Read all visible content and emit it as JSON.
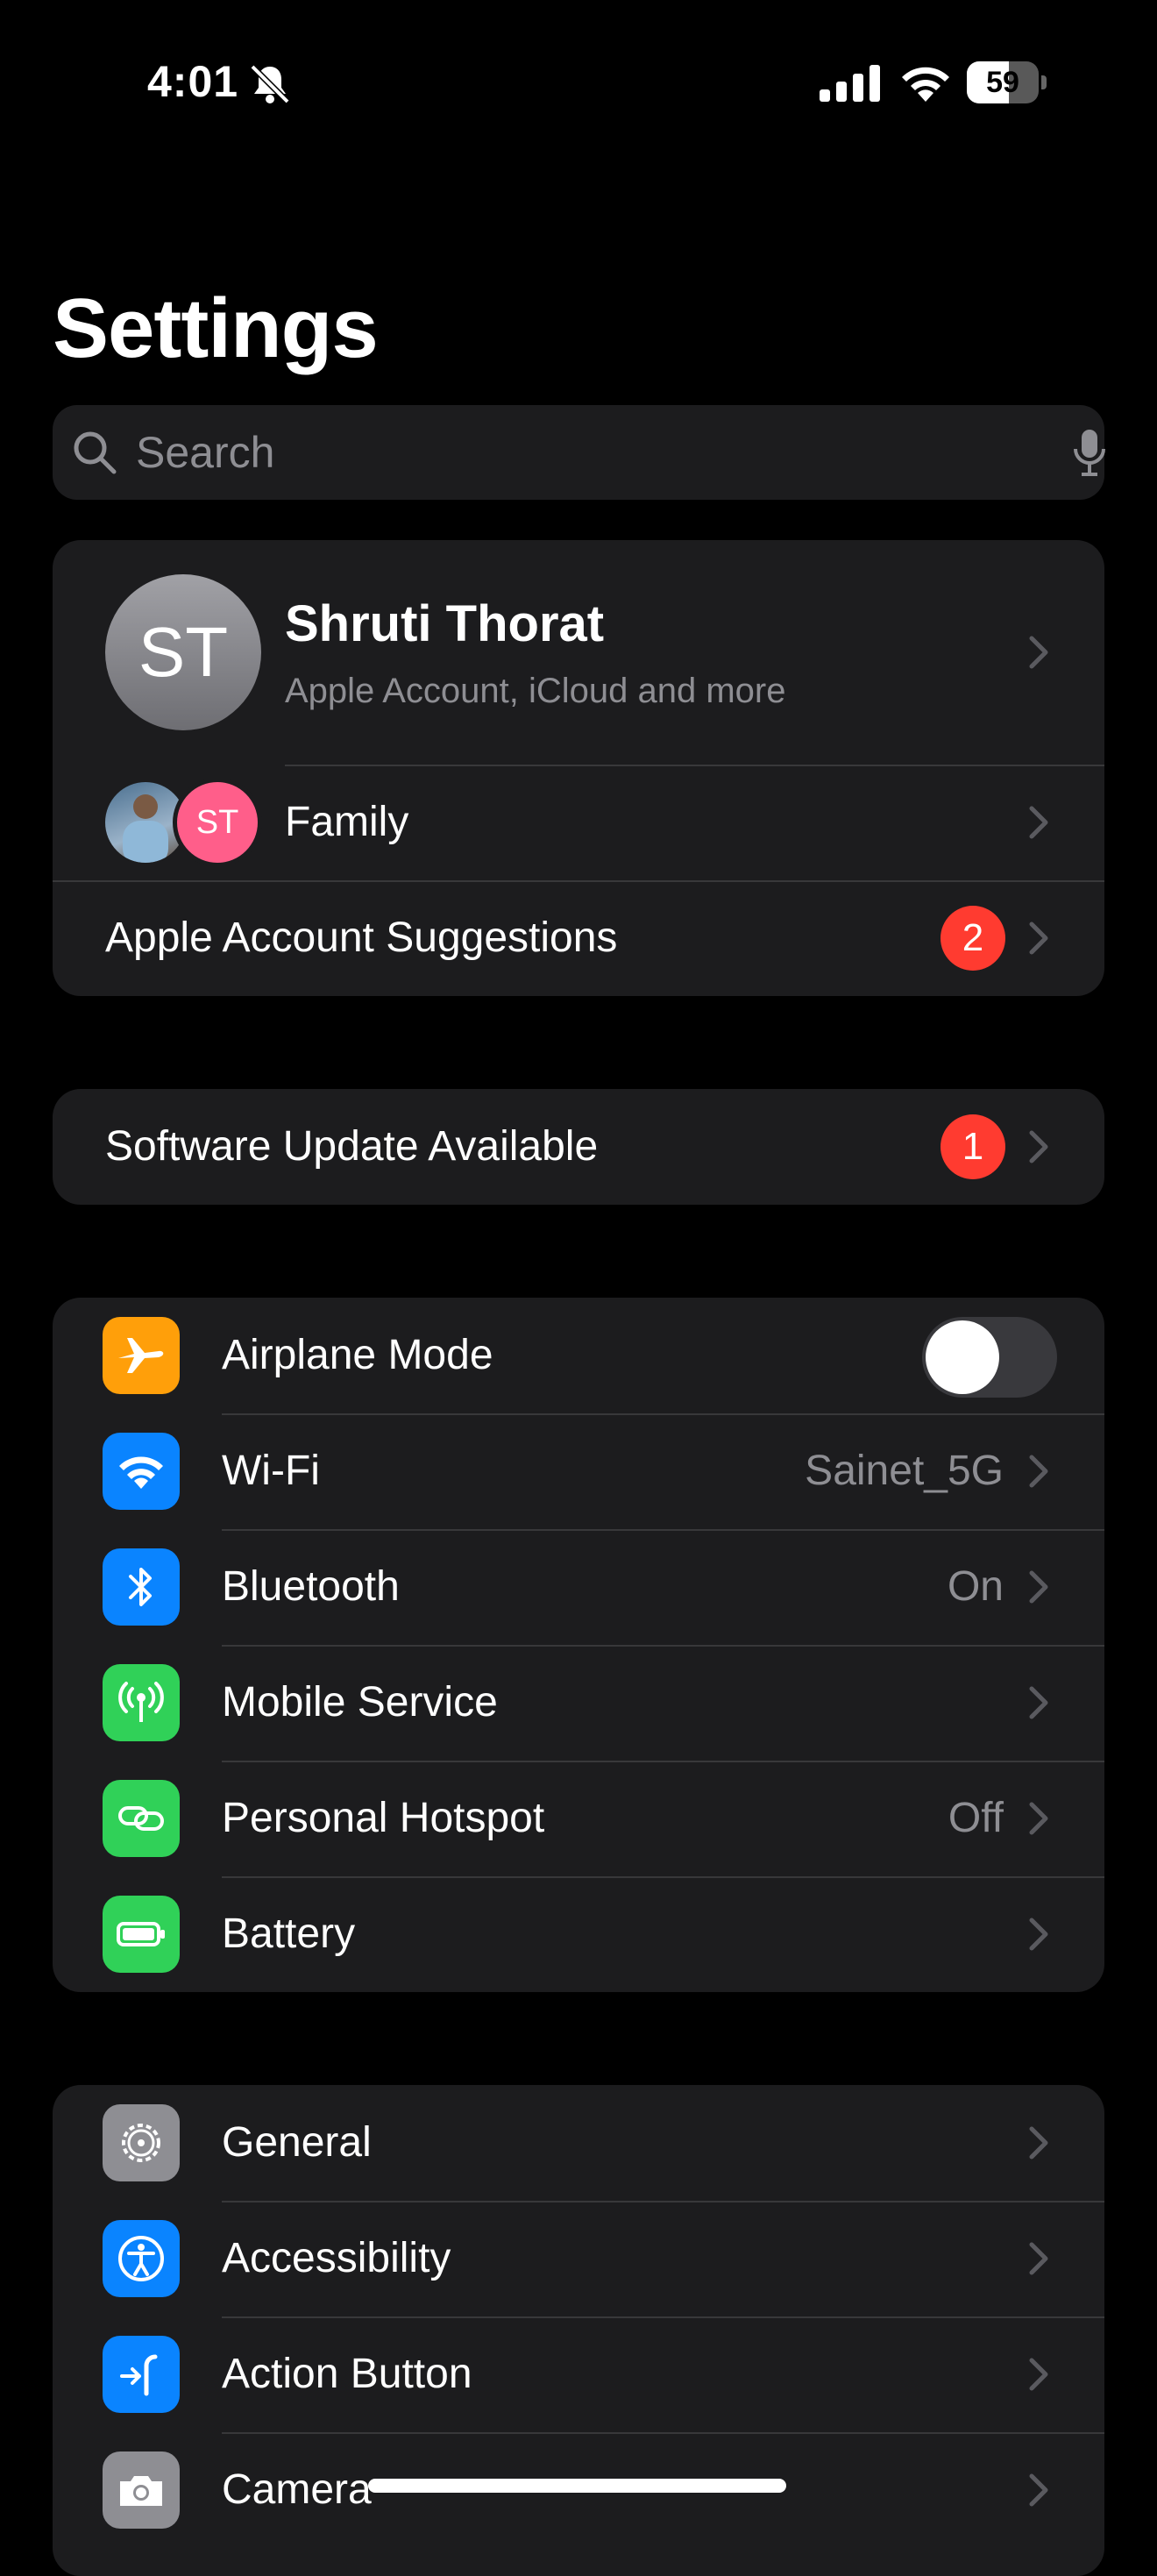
{
  "status_bar": {
    "time": "4:01",
    "battery_level": "59",
    "battery_fraction": 0.59
  },
  "page_title": "Settings",
  "search": {
    "placeholder": "Search"
  },
  "profile": {
    "initials": "ST",
    "name": "Shruti Thorat",
    "subtitle": "Apple Account, iCloud and more",
    "family_label": "Family",
    "family_avatar_initials": "ST",
    "suggestions_label": "Apple Account Suggestions",
    "suggestions_badge": "2"
  },
  "software_update": {
    "label": "Software Update Available",
    "badge": "1"
  },
  "connectivity": {
    "airplane": {
      "label": "Airplane Mode",
      "on": false
    },
    "wifi": {
      "label": "Wi-Fi",
      "value": "Sainet_5G"
    },
    "bluetooth": {
      "label": "Bluetooth",
      "value": "On"
    },
    "mobile": {
      "label": "Mobile Service"
    },
    "hotspot": {
      "label": "Personal Hotspot",
      "value": "Off"
    },
    "battery": {
      "label": "Battery"
    }
  },
  "system": {
    "general": {
      "label": "General"
    },
    "accessibility": {
      "label": "Accessibility"
    },
    "action_button": {
      "label": "Action Button"
    },
    "camera": {
      "label": "Camera"
    }
  },
  "colors": {
    "airplane": "#ff9f0a",
    "wifi": "#0a84ff",
    "bluetooth": "#0a84ff",
    "mobile": "#30d158",
    "hotspot": "#30d158",
    "battery": "#30d158",
    "general": "#8e8e93",
    "accessibility": "#0a84ff",
    "action_button": "#0a84ff",
    "camera": "#8e8e93",
    "badge": "#ff3b30"
  }
}
